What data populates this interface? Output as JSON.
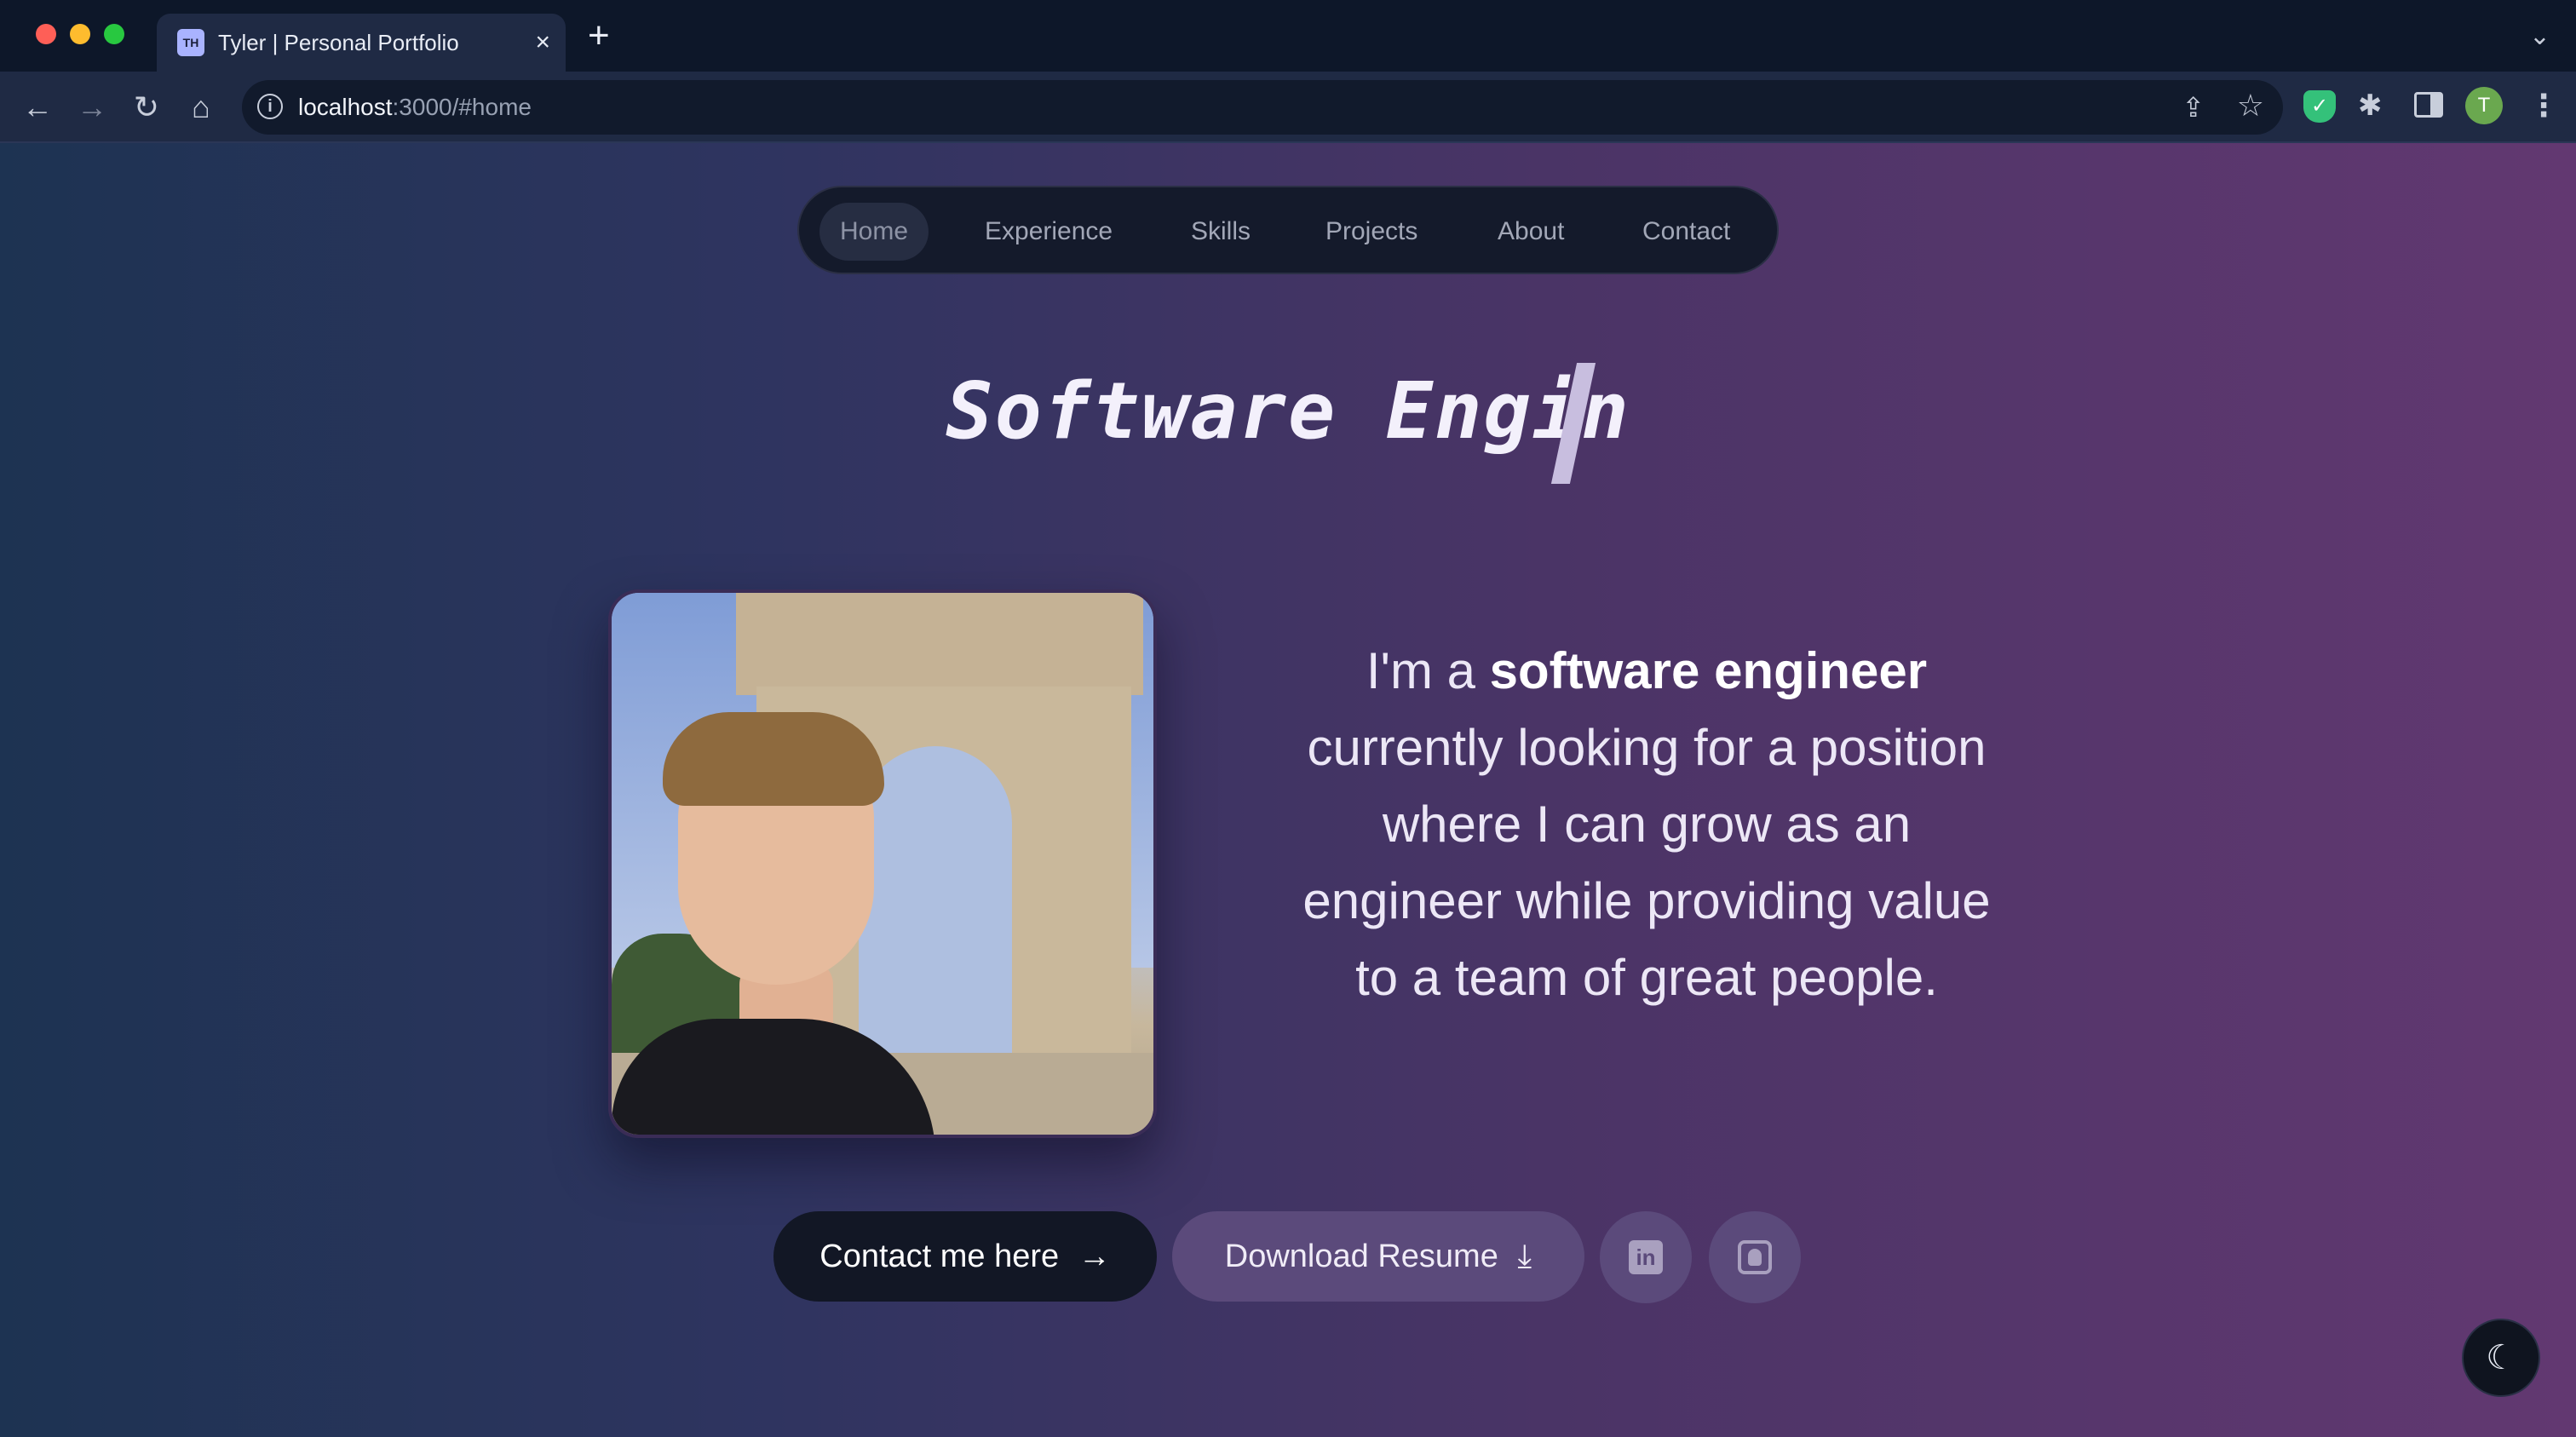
{
  "browser": {
    "tab": {
      "favicon": "TH",
      "title": "Tyler | Personal Portfolio",
      "close_icon": "×"
    },
    "new_tab_icon": "+",
    "tab_list_icon": "⌄",
    "toolbar": {
      "back": "←",
      "forward": "→",
      "reload": "↻",
      "home": "⌂"
    },
    "address": {
      "host": "localhost",
      "path": ":3000/#home",
      "info_icon": "i"
    },
    "omnibox_icons": {
      "share": "⇪",
      "bookmark": "☆"
    },
    "extensions": {
      "shield": "✓",
      "puzzle": "✱"
    },
    "profile_initial": "T",
    "menu_icon": "⋮"
  },
  "nav": {
    "items": [
      {
        "label": "Home",
        "active": true
      },
      {
        "label": "Experience"
      },
      {
        "label": "Skills"
      },
      {
        "label": "Projects"
      },
      {
        "label": "About"
      },
      {
        "label": "Contact"
      }
    ]
  },
  "hero": {
    "typed_headline": "Software Engin",
    "intro_prefix": "I'm a ",
    "intro_bold": "software engineer",
    "intro_rest": "currently looking for a position where I can grow as an engineer while providing value to a team of great people."
  },
  "actions": {
    "contact_label": "Contact me here",
    "contact_arrow": "→",
    "resume_label": "Download Resume",
    "resume_icon": "⤓",
    "linkedin_icon": "in",
    "github_icon": "github-icon"
  },
  "theme_toggle_icon": "☾"
}
